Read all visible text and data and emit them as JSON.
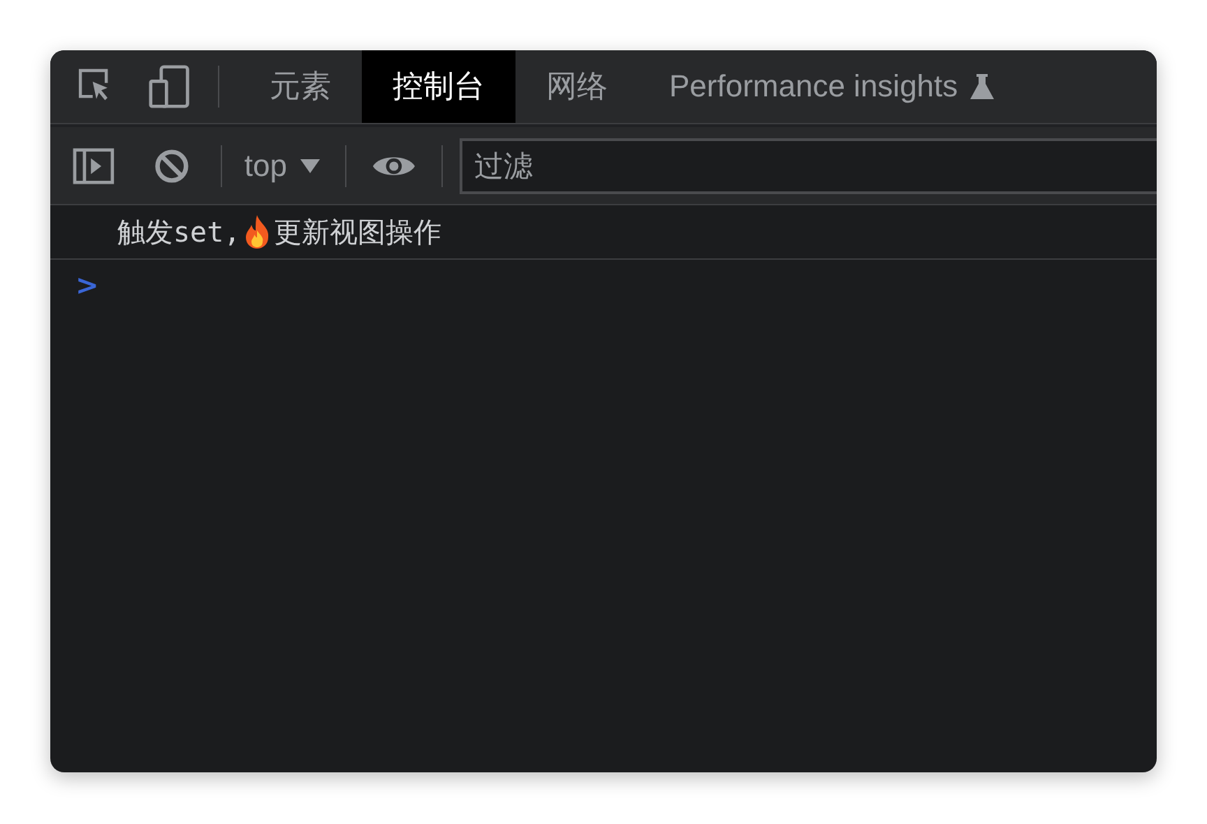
{
  "tabs": [
    {
      "label": "元素",
      "selected": false
    },
    {
      "label": "控制台",
      "selected": true
    },
    {
      "label": "网络",
      "selected": false
    },
    {
      "label": "Performance insights",
      "selected": false,
      "experimental": true
    }
  ],
  "toolbar": {
    "context": "top",
    "filter": {
      "placeholder": "过滤"
    }
  },
  "messages": [
    {
      "before": "触发set,",
      "after": "更新视图操作"
    }
  ],
  "prompt": ">"
}
